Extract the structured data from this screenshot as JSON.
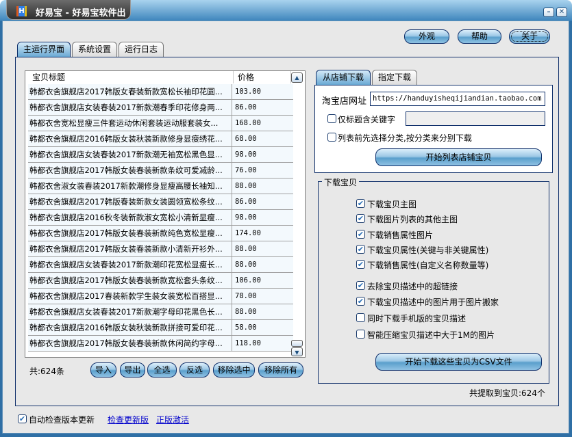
{
  "window": {
    "title": "好易宝 - 好易宝软件出品",
    "minimize": "–",
    "close": "✕"
  },
  "top_buttons": {
    "appearance": "外观",
    "help": "帮助",
    "about": "关于"
  },
  "tabs": [
    "主运行界面",
    "系统设置",
    "运行日志"
  ],
  "list": {
    "columns": [
      "宝贝标题",
      "价格"
    ],
    "rows": [
      [
        "韩都衣舍旗舰店2017韩版女春装新款宽松长袖印花圆...",
        "103.00"
      ],
      [
        "韩都衣舍旗舰店女装春装2017新款潮春季印花修身两...",
        "86.00"
      ],
      [
        "韩都衣舍宽松显瘦三件套运动休闲套装运动服套装女...",
        "168.00"
      ],
      [
        "韩都衣舍旗舰店2016韩版女装秋装新款修身显瘦绣花...",
        "68.00"
      ],
      [
        "韩都衣舍旗舰店女装春装2017新款潮无袖宽松黑色显...",
        "98.00"
      ],
      [
        "韩都衣舍旗舰店2017韩版女装春装新款条纹可爱减龄...",
        "76.00"
      ],
      [
        "韩都衣舍淑女装春装2017新款潮修身显瘦高腰长袖知...",
        "88.00"
      ],
      [
        "韩都衣舍旗舰店2017韩版春装新款女装圆领宽松条纹...",
        "86.00"
      ],
      [
        "韩都衣舍旗舰店2016秋冬装新款淑女宽松小清新显瘦...",
        "98.00"
      ],
      [
        "韩都衣舍旗舰店2017韩版女装春装新款纯色宽松显瘦...",
        "174.00"
      ],
      [
        "韩都衣舍旗舰店2017韩版女装春装新款小清新开衫外...",
        "88.00"
      ],
      [
        "韩都衣舍旗舰店女装春装2017新款潮印花宽松显瘦长...",
        "88.00"
      ],
      [
        "韩都衣舍旗舰店2017韩版女装春装新款宽松套头条纹...",
        "106.00"
      ],
      [
        "韩都衣舍旗舰店2017春装新款学生装女装宽松百搭显...",
        "78.00"
      ],
      [
        "韩都衣舍旗舰店女装春装2017新款潮字母印花黑色长...",
        "88.00"
      ],
      [
        "韩都衣舍旗舰店2016韩版女装秋装新款拼接可爱印花...",
        "58.00"
      ],
      [
        "韩都衣舍旗舰店2017韩版女装春装新款休闲简约字母...",
        "118.00"
      ]
    ],
    "count": "共:624条"
  },
  "list_buttons": [
    "导入",
    "导出",
    "全选",
    "反选",
    "移除选中",
    "移除所有"
  ],
  "right_tabs": [
    "从店铺下载",
    "指定下载"
  ],
  "shop": {
    "url_label": "淘宝店网址",
    "url_value": "https://handuyisheqijiandian.taobao.com",
    "keyword_label": "仅标题含关键字",
    "keyword_checked": false,
    "keyword_value": "",
    "category_label": "列表前先选择分类,按分类来分别下载",
    "category_checked": false,
    "list_button": "开始列表店铺宝贝"
  },
  "download": {
    "group_label": "下载宝贝",
    "options": [
      {
        "label": "下载宝贝主图",
        "checked": true
      },
      {
        "label": "下载图片列表的其他主图",
        "checked": true
      },
      {
        "label": "下载销售属性图片",
        "checked": true
      },
      {
        "label": "下载宝贝属性(关键与非关键属性)",
        "checked": true
      },
      {
        "label": "下载销售属性(自定义名称数量等)",
        "checked": true
      },
      {
        "label": "去除宝贝描述中的超链接",
        "checked": true
      },
      {
        "label": "下载宝贝描述中的图片用于图片搬家",
        "checked": true
      },
      {
        "label": "同时下载手机版的宝贝描述",
        "checked": false
      },
      {
        "label": "智能压缩宝贝描述中大于1M的图片",
        "checked": false
      }
    ],
    "csv_button": "开始下载这些宝贝为CSV文件"
  },
  "total": "共提取到宝贝:624个",
  "footer": {
    "auto_update_label": "自动检查版本更新",
    "auto_update_checked": true,
    "check_update": "检查更新版",
    "activate": "正版激活"
  },
  "check_mark": "✔"
}
